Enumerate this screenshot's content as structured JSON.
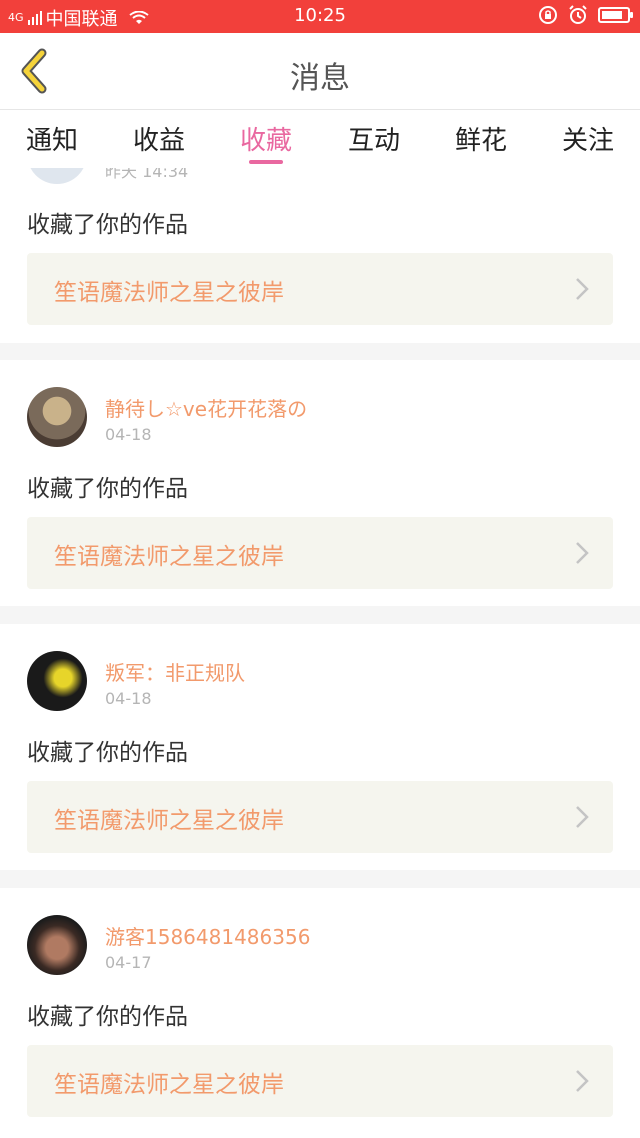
{
  "status_bar": {
    "signal": "4G",
    "carrier": "中国联通",
    "time": "10:25",
    "battery_level": 0.85
  },
  "header": {
    "title": "消息"
  },
  "tabs": [
    {
      "label": "通知",
      "active": false
    },
    {
      "label": "收益",
      "active": false
    },
    {
      "label": "收藏",
      "active": true
    },
    {
      "label": "互动",
      "active": false
    },
    {
      "label": "鲜花",
      "active": false
    },
    {
      "label": "关注",
      "active": false
    }
  ],
  "items": [
    {
      "user": "",
      "date": "昨天 14:34",
      "action": "收藏了你的作品",
      "work": "笙语魔法师之星之彼岸"
    },
    {
      "user": "静待し☆ve花开花落の",
      "date": "04-18",
      "action": "收藏了你的作品",
      "work": "笙语魔法师之星之彼岸"
    },
    {
      "user": "叛军：非正规队",
      "date": "04-18",
      "action": "收藏了你的作品",
      "work": "笙语魔法师之星之彼岸"
    },
    {
      "user": "游客1586481486356",
      "date": "04-17",
      "action": "收藏了你的作品",
      "work": "笙语魔法师之星之彼岸"
    }
  ],
  "colors": {
    "status_bar": "#f2403b",
    "accent_pink": "#e968a0",
    "name_orange": "#f29a6c"
  },
  "icons": {
    "back": "chevron-left-icon",
    "wifi": "wifi-icon",
    "lock": "rotation-lock-icon",
    "alarm": "alarm-icon",
    "battery": "battery-icon",
    "chevron": "chevron-right-icon"
  }
}
